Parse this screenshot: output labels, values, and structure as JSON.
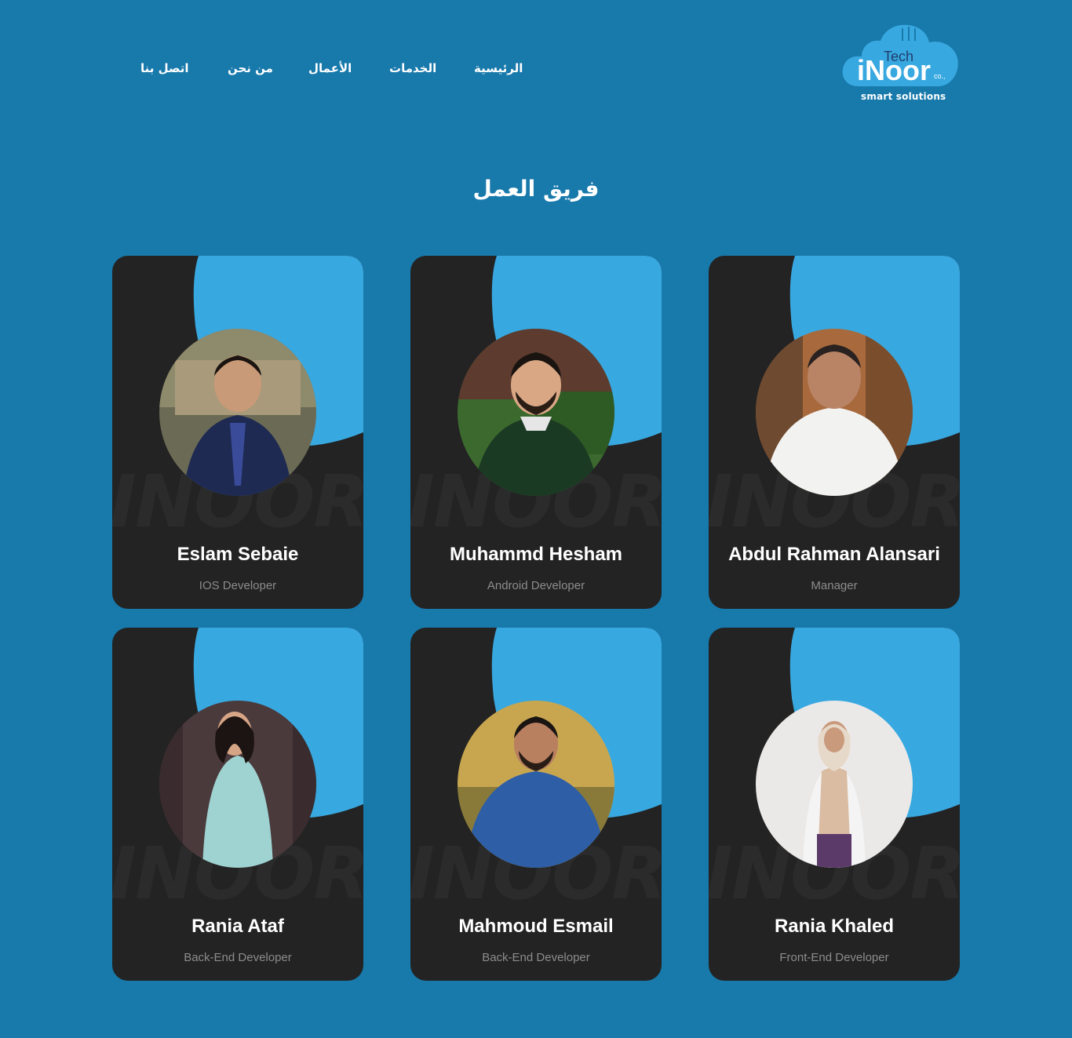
{
  "nav": {
    "items": [
      {
        "label": "الرئيسية"
      },
      {
        "label": "الخدمات"
      },
      {
        "label": "الأعمال"
      },
      {
        "label": "من نحن"
      },
      {
        "label": "اتصل بنا"
      }
    ]
  },
  "logo": {
    "tech": "Tech",
    "name": "iNoor",
    "suffix": "co.,",
    "tagline": "smart solutions"
  },
  "section": {
    "title": "فريق العمل"
  },
  "team": [
    {
      "name": "Eslam Sebaie",
      "role": "IOS Developer"
    },
    {
      "name": "Muhammd Hesham",
      "role": "Android Developer"
    },
    {
      "name": "Abdul Rahman Alansari",
      "role": "Manager"
    },
    {
      "name": "Rania Ataf",
      "role": "Back-End Developer"
    },
    {
      "name": "Mahmoud Esmail",
      "role": "Back-End Developer"
    },
    {
      "name": "Rania Khaled",
      "role": "Front-End Developer"
    }
  ],
  "card_watermark": "INOOR",
  "colors": {
    "background": "#1879ab",
    "card": "#232323",
    "accent": "#38a8e0"
  }
}
